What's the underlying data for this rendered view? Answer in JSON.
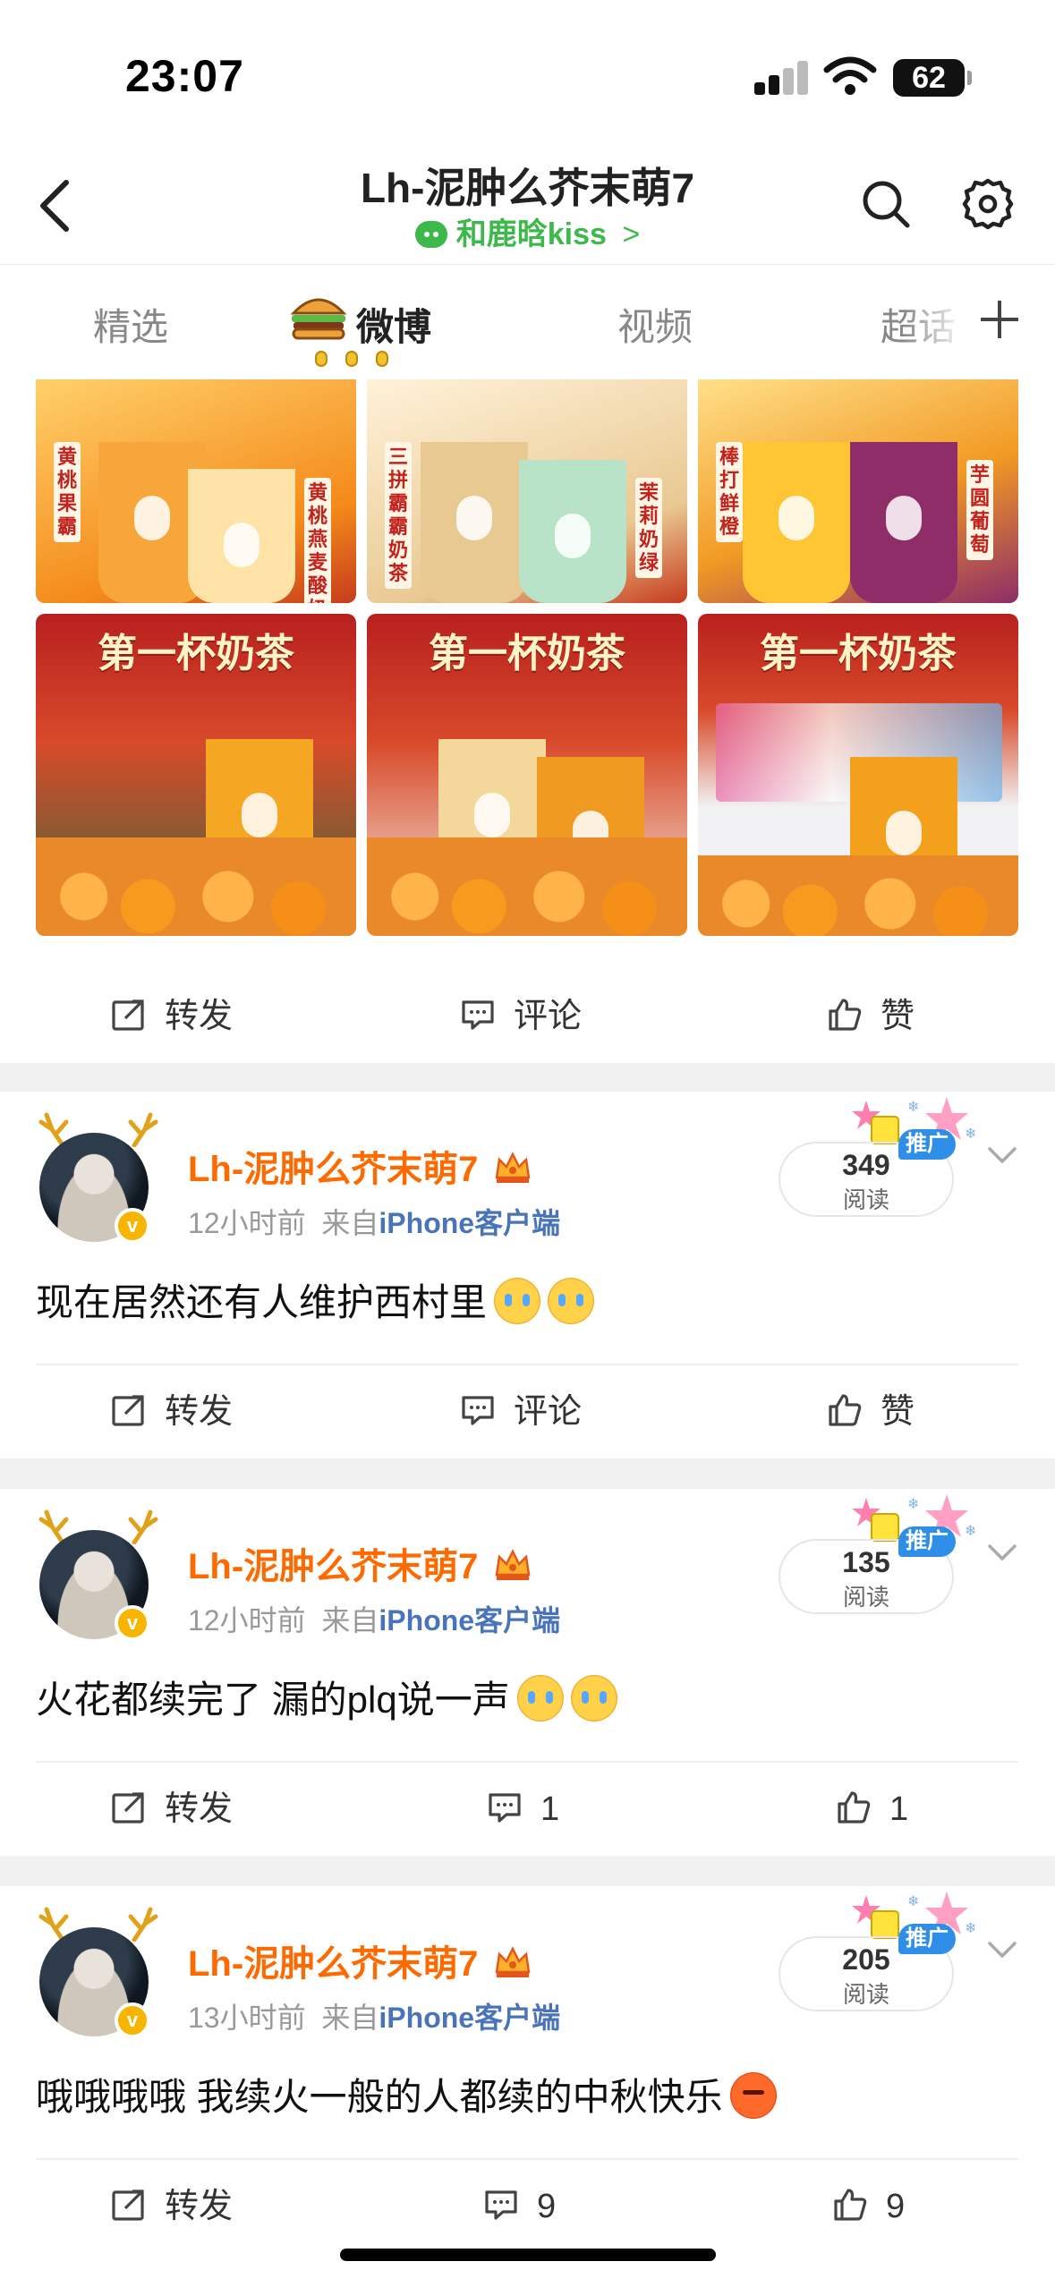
{
  "status_bar": {
    "time": "23:07",
    "battery": "62"
  },
  "header": {
    "title": "Lh-泥肿么芥末萌7",
    "subtitle": "和鹿晗kiss",
    "subtitle_arrow": ">"
  },
  "tabs": [
    {
      "label": "精选"
    },
    {
      "label": "微博"
    },
    {
      "label": "视频"
    },
    {
      "label": "超话"
    }
  ],
  "top_post": {
    "image_tiles": [
      {
        "labels": [
          "黄桃果霸",
          "黄桃燕麦酸奶"
        ],
        "theme": "#f7a63a"
      },
      {
        "labels": [
          "三拼霸霸奶茶",
          "茉莉奶绿"
        ],
        "theme": "#e9c992"
      },
      {
        "labels": [
          "棒打鲜橙",
          "芋圆葡萄"
        ],
        "theme": "#c14a7c"
      },
      {
        "banner": "第一杯奶茶",
        "theme": "#c9272d"
      },
      {
        "banner": "第一杯奶茶",
        "theme": "#c9272d"
      },
      {
        "banner": "第一杯奶茶",
        "theme": "#c9272d"
      }
    ],
    "actions": {
      "repost": "转发",
      "comment": "评论",
      "like": "赞"
    }
  },
  "posts": [
    {
      "username": "Lh-泥肿么芥末萌7",
      "time": "12小时前",
      "from": "来自",
      "source": "iPhone客户端",
      "reads": "349",
      "reads_label": "阅读",
      "promo": "推广",
      "text": "现在居然还有人维护西村里",
      "emojis": [
        "cry",
        "cry"
      ],
      "actions": {
        "repost": "转发",
        "comment": "评论",
        "like": "赞"
      }
    },
    {
      "username": "Lh-泥肿么芥末萌7",
      "time": "12小时前",
      "from": "来自",
      "source": "iPhone客户端",
      "reads": "135",
      "reads_label": "阅读",
      "promo": "推广",
      "text": "火花都续完了 漏的plq说一声",
      "emojis": [
        "cry",
        "cry"
      ],
      "actions": {
        "repost": "转发",
        "comment": "1",
        "like": "1"
      }
    },
    {
      "username": "Lh-泥肿么芥末萌7",
      "time": "13小时前",
      "from": "来自",
      "source": "iPhone客户端",
      "reads": "205",
      "reads_label": "阅读",
      "promo": "推广",
      "text": "哦哦哦哦 我续火一般的人都续的中秋快乐",
      "emojis": [
        "angry"
      ],
      "actions": {
        "repost": "转发",
        "comment": "9",
        "like": "9"
      }
    }
  ],
  "colors": {
    "accent_orange": "#ff6a00",
    "link_blue": "#4a74b9",
    "wechat_green": "#3db84a",
    "promo_blue": "#2f8fe8",
    "vip_gold": "#f7b500"
  },
  "icons": [
    "back-icon",
    "search-icon",
    "gear-icon",
    "plus-icon",
    "repost-icon",
    "comment-icon",
    "like-icon",
    "chevron-down-icon",
    "crown-icon",
    "verified-icon"
  ]
}
